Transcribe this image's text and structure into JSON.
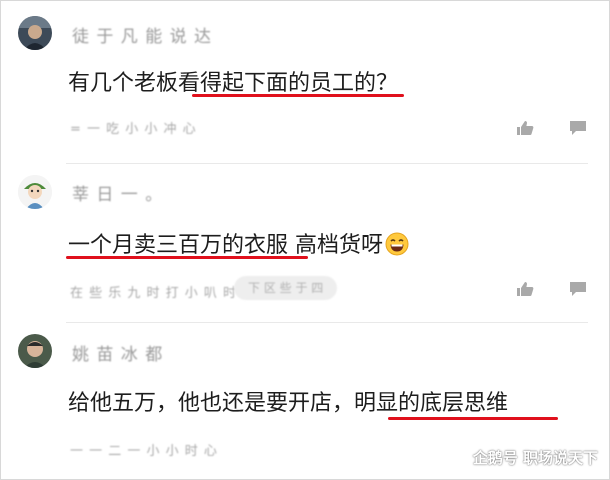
{
  "comments": [
    {
      "username": "徒 于 凡 能 说 达",
      "text": "有几个老板看得起下面的员工的？",
      "meta": "= 一 吃 小 小 冲 心",
      "meta_pill": ""
    },
    {
      "username": "莘 日 一 。",
      "text_a": "一个月卖三百万的衣服",
      "text_b": "高档货呀",
      "meta": "在 些 乐 九 时 打 小 叭 时 。。",
      "meta_pill": "下 区 些 于 四"
    },
    {
      "username": "姚 苗 冰 都",
      "text": "给他五万，他也还是要开店，明显的底层思维",
      "meta": "一 一 二 一 小 小 时 心",
      "meta_pill": ""
    }
  ],
  "watermark": "企鹅号 职场说天下",
  "icons": {
    "like": "thumbs-up-icon",
    "reply": "comment-icon",
    "emoji": "grinning-emoji"
  },
  "colors": {
    "underline": "#e0101c",
    "action_icon": "#a9a9a9"
  }
}
